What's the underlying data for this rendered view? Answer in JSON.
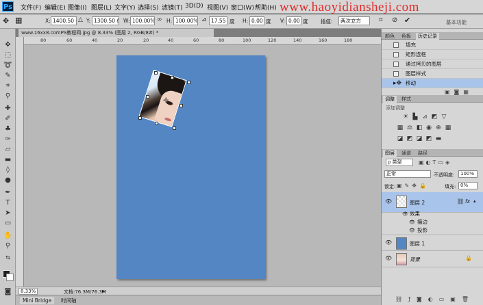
{
  "app": {
    "logo": "Ps"
  },
  "menu": [
    "文件(F)",
    "编辑(E)",
    "图像(I)",
    "图层(L)",
    "文字(Y)",
    "选择(S)",
    "滤镜(T)",
    "3D(D)",
    "视图(V)",
    "窗口(W)",
    "帮助(H)"
  ],
  "watermark": "www.haoyidiansheji.com",
  "options": {
    "x_label": "X:",
    "x_value": "1400.50 像",
    "y_label": "Y:",
    "y_value": "1300.50 像",
    "w_label": "W:",
    "w_value": "100.00%",
    "h_label": "H:",
    "h_value": "100.00%",
    "angle_value": "17.55",
    "angle_unit": "度",
    "hskew_label": "H:",
    "hskew_value": "0.00",
    "hskew_unit": "度",
    "vskew_label": "V:",
    "vskew_value": "0.00",
    "vskew_unit": "度",
    "interp_label": "插值:",
    "interp_value": "两次立方",
    "workspace": "基本功能"
  },
  "document": {
    "tab_title": "www.16xx8.comPS教程网.jpg @ 8.33% (图层 2, RGB/8#) *"
  },
  "ruler": {
    "h": [
      "80",
      "60",
      "40",
      "20",
      "0",
      "20",
      "40",
      "60",
      "80",
      "100",
      "120",
      "140",
      "160",
      "180"
    ]
  },
  "status": {
    "zoom": "8.33%",
    "doc_info": "文档:76.3M/76.3M"
  },
  "bottom_tabs": [
    "Mini Bridge",
    "时间轴"
  ],
  "history_panel": {
    "tabs": [
      "颜色",
      "色板",
      "历史记录"
    ],
    "items": [
      "填充",
      "矩形选框",
      "通过拷贝的图层",
      "图层样式",
      "移动"
    ],
    "selected_index": 4
  },
  "adjustments_panel": {
    "tabs": [
      "调整",
      "样式"
    ],
    "hint": "添加调整"
  },
  "layers_panel": {
    "tabs": [
      "图层",
      "通道",
      "路径"
    ],
    "filter_kind": "ρ 类型",
    "blend_mode": "正常",
    "opacity_label": "不透明度:",
    "opacity_value": "100%",
    "lock_label": "锁定:",
    "fill_label": "填充:",
    "fill_value": "0%",
    "layers": [
      {
        "name": "图层 2",
        "selected": true
      },
      {
        "name": "图层 1",
        "selected": false
      },
      {
        "name": "背景",
        "selected": false
      }
    ],
    "effects_label": "效果",
    "effects": [
      "描边",
      "投影"
    ],
    "fx": "fx"
  },
  "colors": {
    "canvas_blue": "#5386c3",
    "selection": "#a8c4ea",
    "watermark": "#e02a2a"
  }
}
